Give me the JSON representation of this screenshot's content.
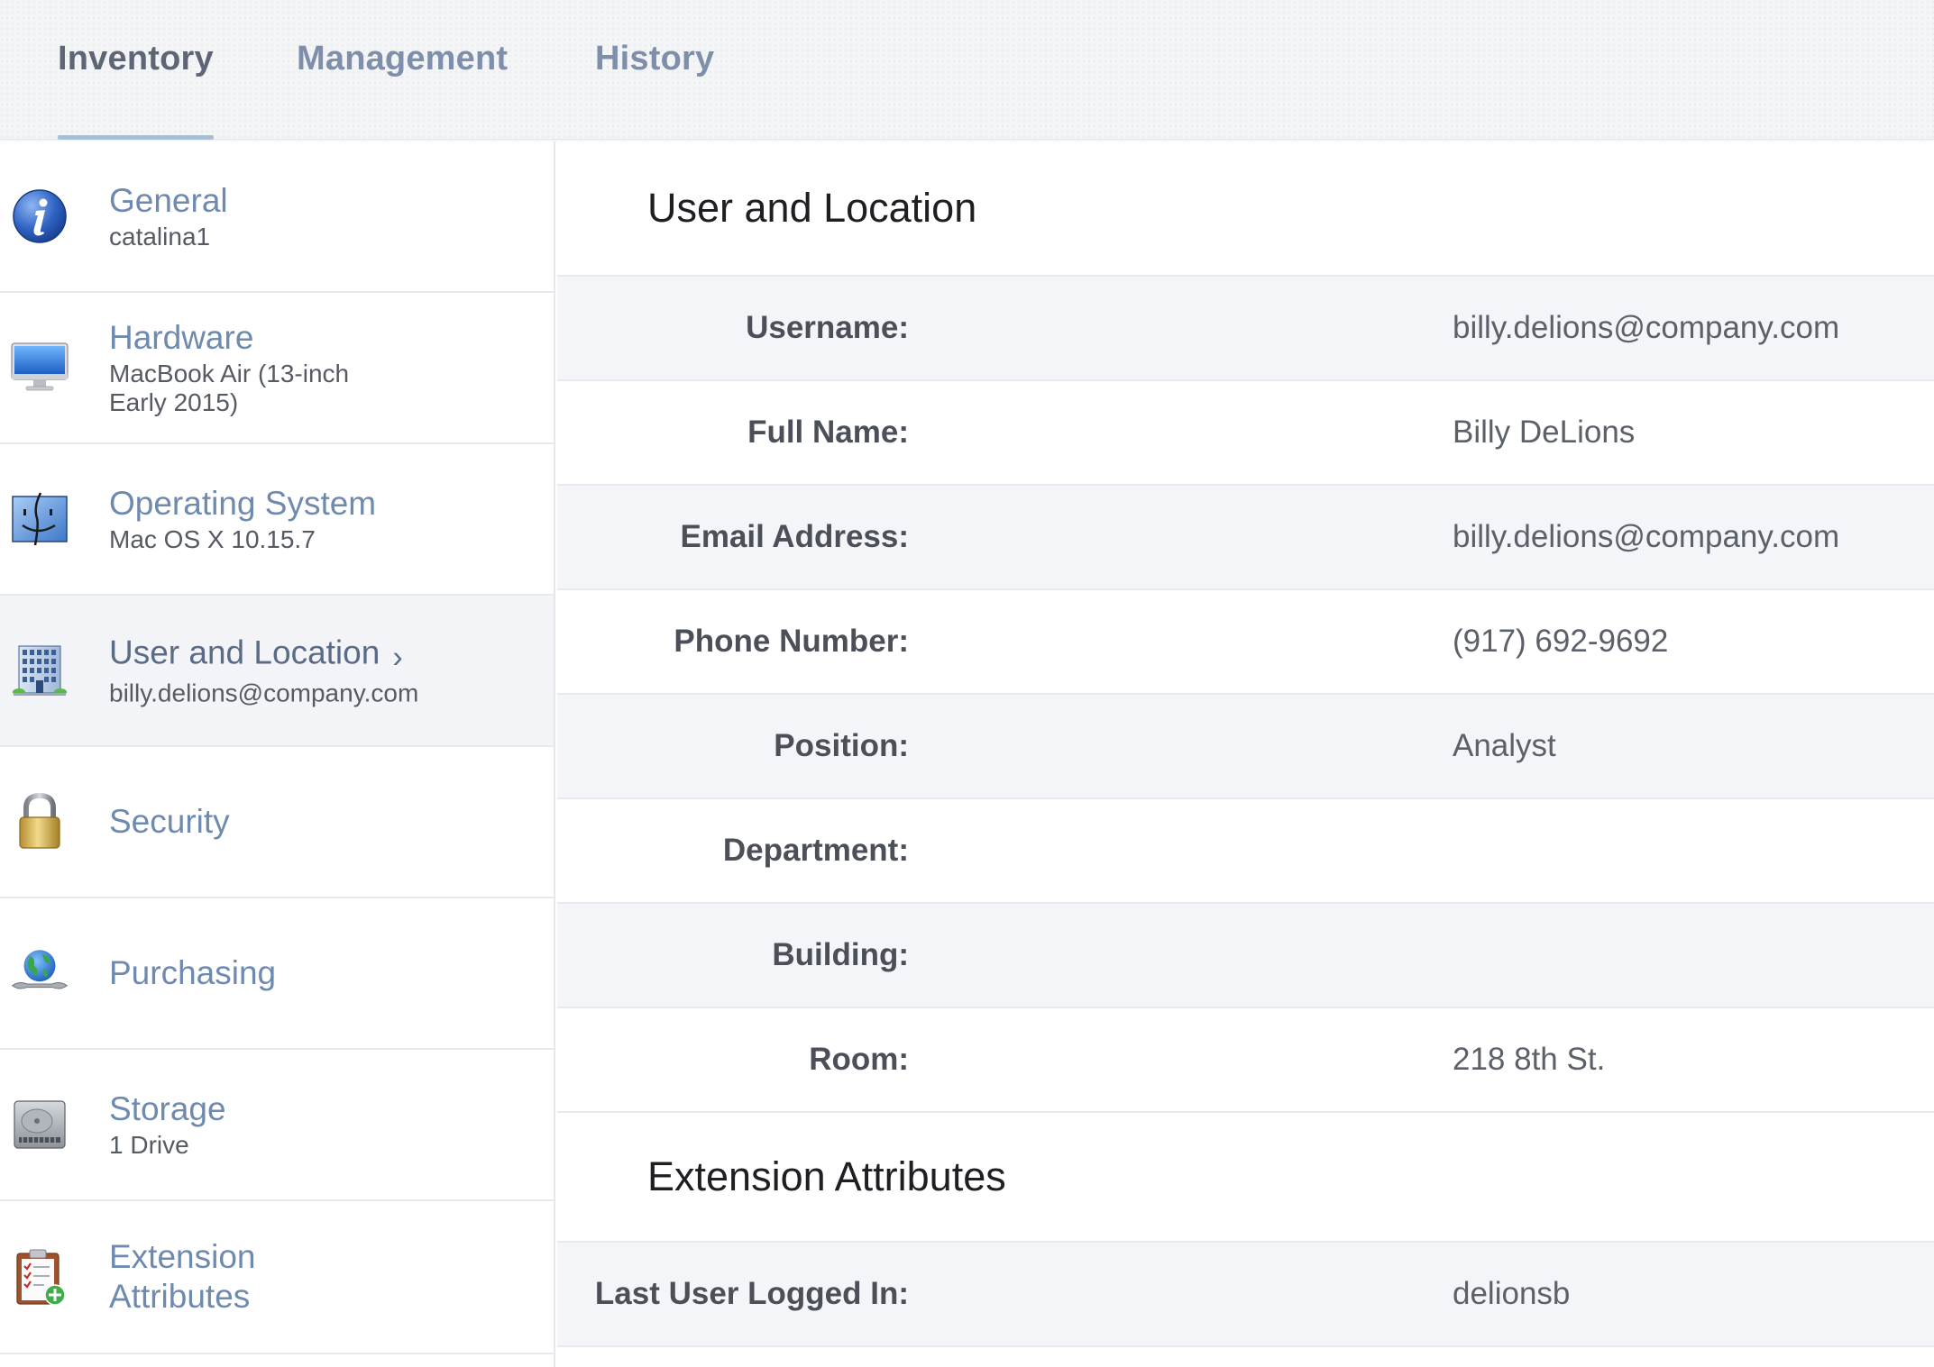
{
  "tabs": [
    {
      "label": "Inventory",
      "active": true
    },
    {
      "label": "Management",
      "active": false
    },
    {
      "label": "History",
      "active": false
    }
  ],
  "sidebar": {
    "items": [
      {
        "title": "General",
        "subtitle": "catalina1",
        "icon": "info-icon"
      },
      {
        "title": "Hardware",
        "subtitle": "MacBook Air (13-inch Early 2015)",
        "icon": "monitor-icon"
      },
      {
        "title": "Operating System",
        "subtitle": "Mac OS X 10.15.7",
        "icon": "finder-icon"
      },
      {
        "title": "User and Location",
        "subtitle": "billy.delions@company.com",
        "icon": "building-icon",
        "selected": true,
        "chevron": "›"
      },
      {
        "title": "Security",
        "subtitle": "",
        "icon": "lock-icon"
      },
      {
        "title": "Purchasing",
        "subtitle": "",
        "icon": "globe-wrench-icon"
      },
      {
        "title": "Storage",
        "subtitle": "1 Drive",
        "icon": "hard-drive-icon"
      },
      {
        "title": "Extension Attributes",
        "subtitle": "",
        "icon": "clipboard-add-icon"
      }
    ]
  },
  "main": {
    "user_location": {
      "title": "User and Location",
      "fields": [
        {
          "label": "Username:",
          "value": "billy.delions@company.com"
        },
        {
          "label": "Full Name:",
          "value": "Billy DeLions"
        },
        {
          "label": "Email Address:",
          "value": "billy.delions@company.com"
        },
        {
          "label": "Phone Number:",
          "value": "(917) 692-9692"
        },
        {
          "label": "Position:",
          "value": "Analyst"
        },
        {
          "label": "Department:",
          "value": ""
        },
        {
          "label": "Building:",
          "value": ""
        },
        {
          "label": "Room:",
          "value": "218 8th St."
        }
      ]
    },
    "extension_attributes": {
      "title": "Extension Attributes",
      "fields": [
        {
          "label": "Last User Logged In:",
          "value": "delionsb"
        }
      ]
    }
  },
  "colors": {
    "link": "#6f8aaf",
    "tab_underline": "#a9bfd4",
    "row_alt": "#f4f5f8",
    "selected_bg": "#f3f4f7"
  }
}
